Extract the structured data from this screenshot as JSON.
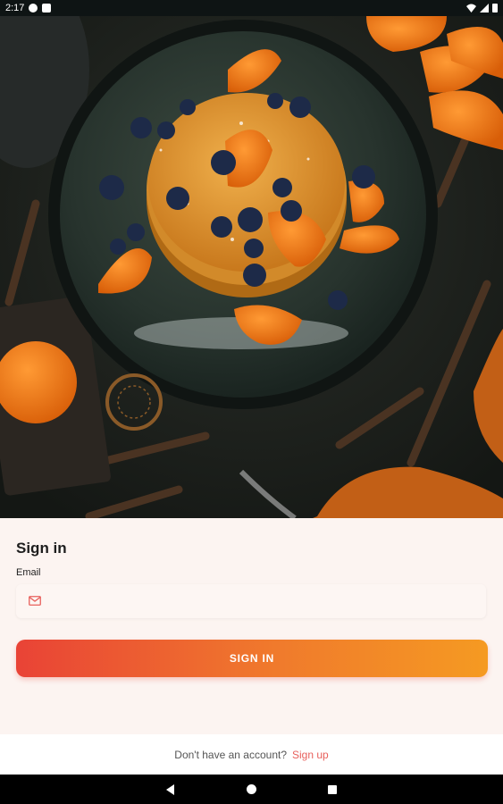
{
  "status_bar": {
    "time": "2:17"
  },
  "hero": {
    "image": "pancakes-with-blueberries-and-mandarin-slices"
  },
  "signin": {
    "title": "Sign in",
    "email_label": "Email",
    "email_value": "",
    "email_placeholder": "",
    "button_label": "SIGN IN"
  },
  "footer": {
    "question": "Don't have an account?",
    "signup_link": "Sign up"
  },
  "colors": {
    "accent_start": "#e94336",
    "accent_end": "#f59a22",
    "link": "#e8605c",
    "card_bg": "#fcf4f1"
  }
}
